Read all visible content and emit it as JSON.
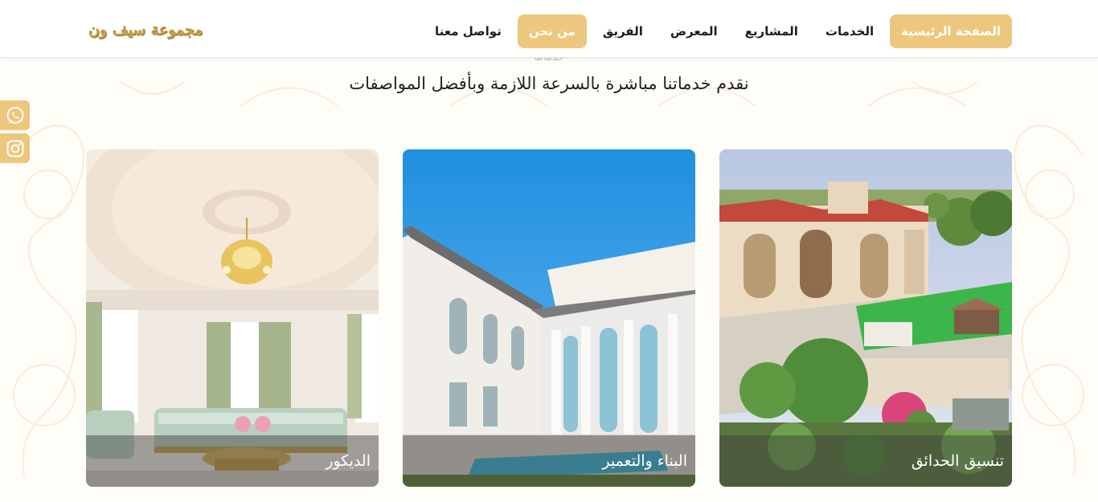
{
  "header": {
    "logo_text": "مجموعة سيف ون",
    "nav": [
      {
        "label": "الصفحة الرئيسية",
        "state": "active"
      },
      {
        "label": "الخدمات",
        "state": ""
      },
      {
        "label": "المشاريع",
        "state": ""
      },
      {
        "label": "المعرض",
        "state": ""
      },
      {
        "label": "الفريق",
        "state": ""
      },
      {
        "label": "من نحن",
        "state": "highlight"
      },
      {
        "label": "تواصل معنا",
        "state": ""
      }
    ]
  },
  "section": {
    "eyebrow": "خدماتنا",
    "subtitle": "نقدم خدماتنا مباشرة بالسرعة اللازمة وبأفضل المواصفات"
  },
  "social": {
    "whatsapp_icon": "whatsapp-icon",
    "instagram_icon": "instagram-icon"
  },
  "cards": [
    {
      "label": "تنسيق الحدائق",
      "image": "villa-garden-photo"
    },
    {
      "label": "البناء والتعمير",
      "image": "white-villa-pool-photo"
    },
    {
      "label": "الديكور",
      "image": "majlis-chandelier-photo"
    }
  ],
  "colors": {
    "accent": "#edc77d",
    "logo": "#c9a24a"
  }
}
